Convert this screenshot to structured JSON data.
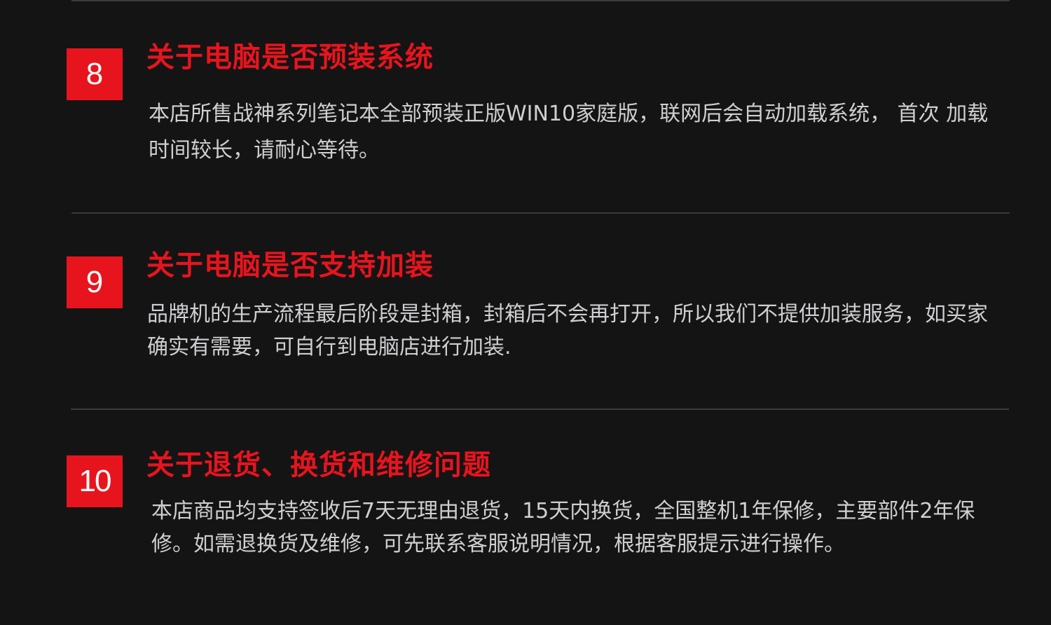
{
  "sections": [
    {
      "number": "8",
      "title": "关于电脑是否预装系统",
      "body": "本店所售战神系列笔记本全部预装正版WIN10家庭版，联网后会自动加载系统， 首次 加载时间较长，请耐心等待。"
    },
    {
      "number": "9",
      "title": "关于电脑是否支持加装",
      "body": "品牌机的生产流程最后阶段是封箱，封箱后不会再打开，所以我们不提供加装服务，如买家确实有需要，可自行到电脑店进行加装."
    },
    {
      "number": "10",
      "title": "关于退货、换货和维修问题",
      "body": "本店商品均支持签收后7天无理由退货，15天内换货，全国整机1年保修，主要部件2年保修。如需退换货及维修，可先联系客服说明情况，根据客服提示进行操作。"
    }
  ],
  "colors": {
    "background": "#151415",
    "accent": "#e8141d",
    "text": "#cfcfd1",
    "divider": "#3a393b"
  }
}
